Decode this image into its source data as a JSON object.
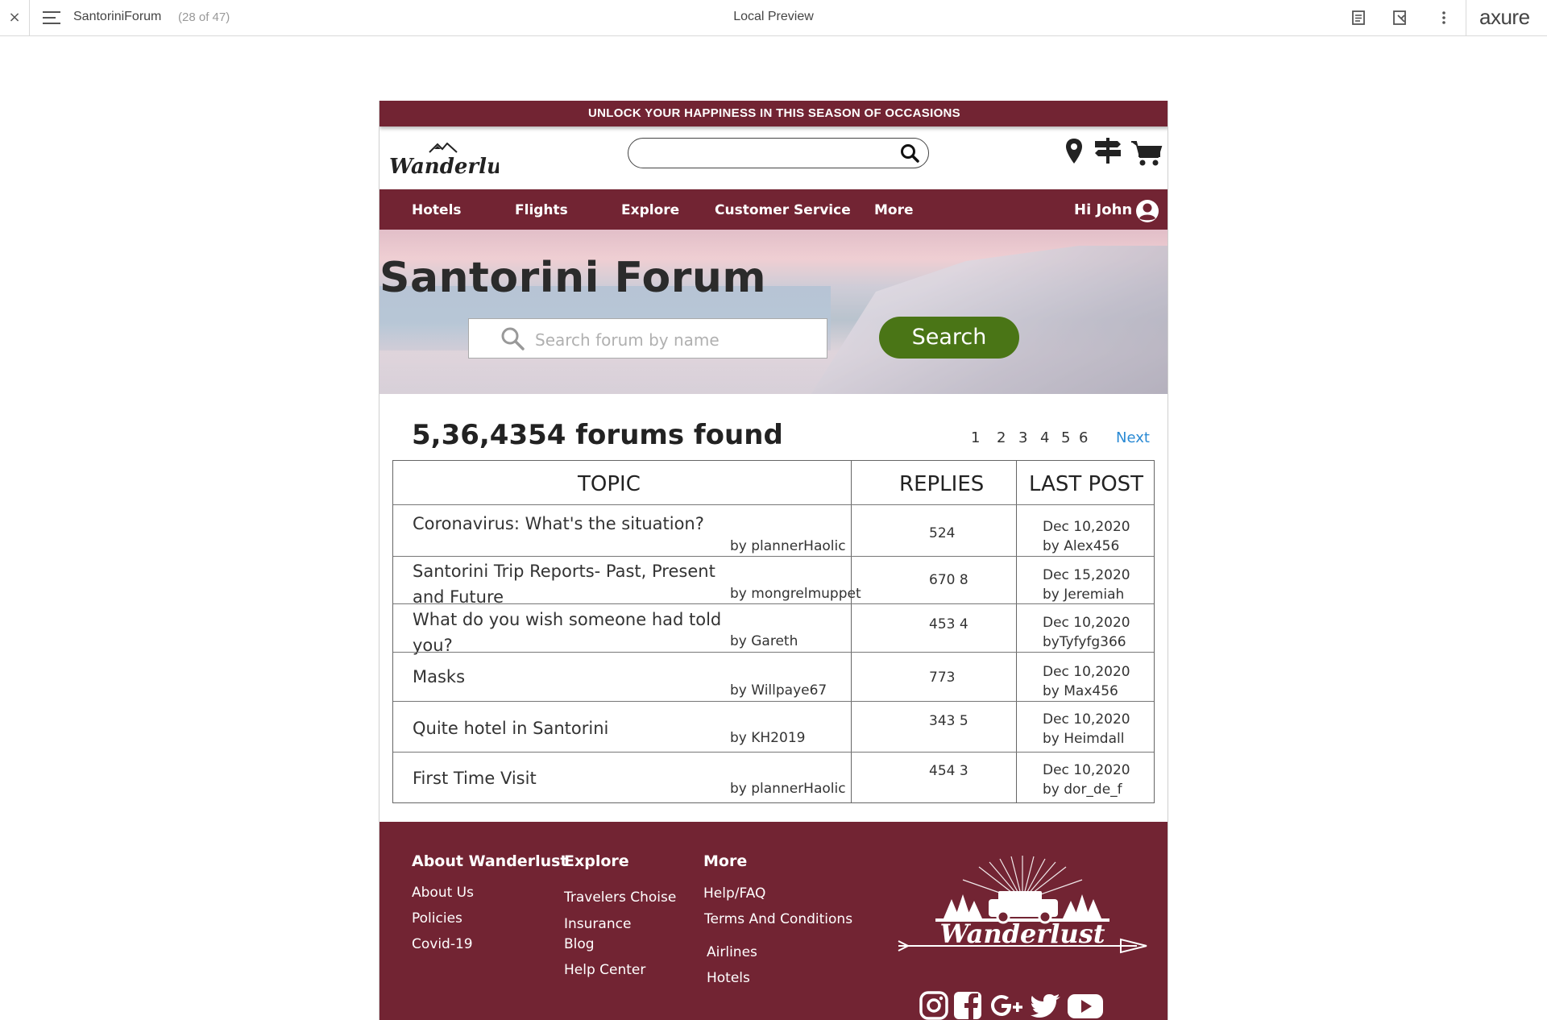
{
  "viewer": {
    "close": "×",
    "page_name": "SantoriniForum",
    "page_count": "(28 of 47)",
    "mode": "Local Preview",
    "brand": "axure"
  },
  "promo": "UNLOCK YOUR HAPPINESS IN THIS SEASON OF OCCASIONS",
  "header": {
    "logo_text": "Wanderlust",
    "search_value": ""
  },
  "nav": {
    "items": [
      "Hotels",
      "Flights",
      "Explore",
      "Customer Service",
      "More"
    ],
    "greeting": "Hi John"
  },
  "hero": {
    "title": "Santorini Forum",
    "search_placeholder": "Search forum by name",
    "search_button": "Search"
  },
  "results": {
    "count": "5,36,4354 forums found",
    "pages": [
      "1",
      "2",
      "3",
      "4",
      "5",
      "6"
    ],
    "next": "Next"
  },
  "table": {
    "headers": [
      "TOPIC",
      "REPLIES",
      "LAST POST"
    ],
    "rows": [
      {
        "topic": "Coronavirus: What's the situation?",
        "by": "by plannerHaolic",
        "replies": "524",
        "last_date": "Dec 10,2020",
        "last_by": "by Alex456"
      },
      {
        "topic": "Santorini Trip Reports- Past, Present and Future",
        "by": "by mongrelmuppet",
        "replies": "670 8",
        "last_date": "Dec 15,2020",
        "last_by": "by Jeremiah"
      },
      {
        "topic": "What do you wish someone had told you?",
        "by": "by Gareth",
        "replies": "453 4",
        "last_date": "Dec 10,2020",
        "last_by": "byTyfyfg366"
      },
      {
        "topic": "Masks",
        "by": "by Willpaye67",
        "replies": "773",
        "last_date": "Dec 10,2020",
        "last_by": "by Max456"
      },
      {
        "topic": "Quite hotel in Santorini",
        "by": "by KH2019",
        "replies": "343 5",
        "last_date": "Dec 10,2020",
        "last_by": "by Heimdall"
      },
      {
        "topic": "First Time Visit",
        "by": "by plannerHaolic",
        "replies": "454 3",
        "last_date": "Dec 10,2020",
        "last_by": "by dor_de_f"
      }
    ]
  },
  "footer": {
    "col1": {
      "heading": "About Wanderlust",
      "links": [
        "About Us",
        "Policies",
        "Covid-19"
      ]
    },
    "col2": {
      "heading": "Explore",
      "links": [
        "Travelers Choise",
        "Insurance",
        "Blog",
        "Help Center"
      ]
    },
    "col3": {
      "heading": "More",
      "links": [
        "Help/FAQ",
        "Terms And Conditions",
        "Airlines",
        "Hotels"
      ]
    },
    "logo_text": "Wanderlust",
    "social": [
      "instagram-icon",
      "facebook-icon",
      "google-plus-icon",
      "twitter-icon",
      "youtube-icon"
    ]
  },
  "colors": {
    "maroon": "#722433",
    "search_green": "#4a7516",
    "link_blue": "#2a8ad4"
  }
}
